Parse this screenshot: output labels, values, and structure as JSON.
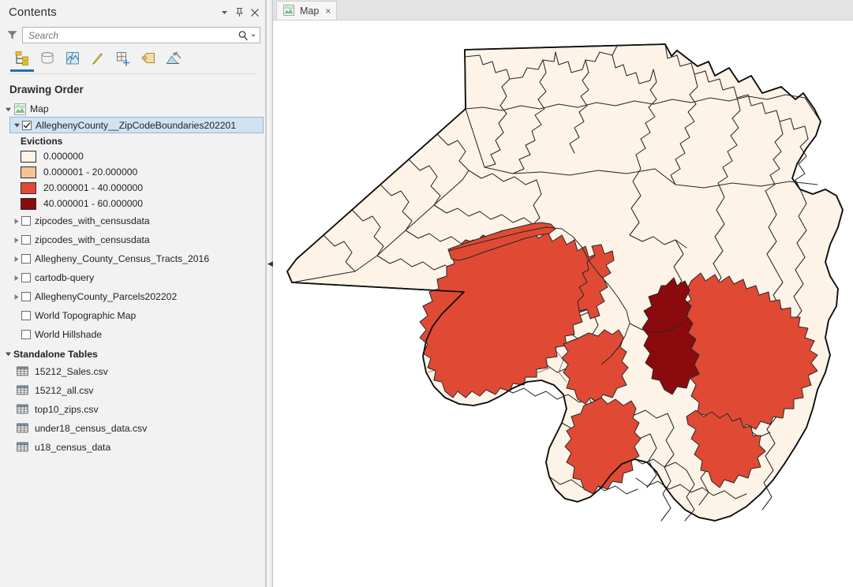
{
  "panel": {
    "title": "Contents",
    "header_buttons": [
      {
        "name": "menu-dropdown",
        "glyph": "caret-down-icon"
      },
      {
        "name": "auto-hide",
        "glyph": "pin-icon"
      },
      {
        "name": "close",
        "glyph": "close-icon"
      }
    ],
    "search": {
      "placeholder": "Search",
      "value": "",
      "filter_icon": "filter-icon",
      "search_icon": "search-icon",
      "dropdown_icon": "chevron-down-icon"
    },
    "toolbar": [
      {
        "name": "list-by-drawing-order",
        "active": true
      },
      {
        "name": "list-by-data-source",
        "active": false
      },
      {
        "name": "list-by-selection",
        "active": false
      },
      {
        "name": "list-by-editing",
        "active": false
      },
      {
        "name": "list-by-snapping",
        "active": false
      },
      {
        "name": "list-by-labeling",
        "active": false
      },
      {
        "name": "list-by-diagram",
        "active": false
      }
    ],
    "drawing_order_label": "Drawing Order",
    "map_node": {
      "label": "Map",
      "expanded": true
    },
    "selected_layer": {
      "label": "AlleghenyCounty__ZipCodeBoundaries202201",
      "checked": true,
      "expanded": true
    },
    "legend": {
      "title": "Evictions",
      "classes": [
        {
          "label": "0.000000",
          "color": "#fdf3e7"
        },
        {
          "label": "0.000001 - 20.000000",
          "color": "#f7c393"
        },
        {
          "label": "20.000001 - 40.000000",
          "color": "#e04a35"
        },
        {
          "label": "40.000001 - 60.000000",
          "color": "#8b0a0e"
        }
      ]
    },
    "layers": [
      {
        "label": "zipcodes_with_censusdata",
        "checked": false,
        "expandable": true
      },
      {
        "label": "zipcodes_with_censusdata",
        "checked": false,
        "expandable": true
      },
      {
        "label": "Allegheny_County_Census_Tracts_2016",
        "checked": false,
        "expandable": true
      },
      {
        "label": "cartodb-query",
        "checked": false,
        "expandable": true
      },
      {
        "label": "AlleghenyCounty_Parcels202202",
        "checked": false,
        "expandable": true
      },
      {
        "label": "World Topographic Map",
        "checked": false,
        "expandable": false
      },
      {
        "label": "World Hillshade",
        "checked": false,
        "expandable": false
      }
    ],
    "standalone_tables_label": "Standalone Tables",
    "tables": [
      {
        "label": "15212_Sales.csv"
      },
      {
        "label": "15212_all.csv"
      },
      {
        "label": "top10_zips.csv"
      },
      {
        "label": "under18_census_data.csv"
      },
      {
        "label": "u18_census_data"
      }
    ]
  },
  "map_view": {
    "tab": {
      "label": "Map",
      "close_glyph": "×",
      "icon": "map-icon"
    },
    "canvas_background": "#ffffff",
    "outline_color": "#0d0d0d",
    "colors": {
      "zero": "#fdf3e7",
      "low": "#f7c393",
      "mid": "#e04a35",
      "high": "#8b0a0e",
      "inner_boundary": "#262626",
      "soft_boundary": "#7a6a62"
    }
  }
}
